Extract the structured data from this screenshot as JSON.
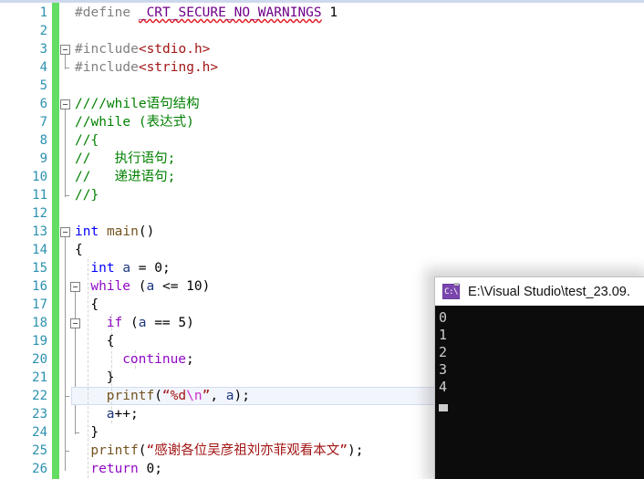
{
  "editor": {
    "name": "code-editor",
    "line_numbers": [
      1,
      2,
      3,
      4,
      5,
      6,
      7,
      8,
      9,
      10,
      11,
      12,
      13,
      14,
      15,
      16,
      17,
      18,
      19,
      20,
      21,
      22,
      23,
      24,
      25,
      26
    ],
    "current_line": 22,
    "lines": [
      {
        "n": 1,
        "indent": 0,
        "segs": [
          {
            "t": "#define ",
            "c": "t-pre"
          },
          {
            "t": "_CRT_SECURE_NO_WARNINGS",
            "c": "t-macro squiggle"
          },
          {
            "t": " ",
            "c": "t-plain"
          },
          {
            "t": "1",
            "c": "t-num"
          }
        ]
      },
      {
        "n": 2,
        "indent": 0,
        "segs": []
      },
      {
        "n": 3,
        "indent": 0,
        "segs": [
          {
            "t": "#include",
            "c": "t-pre"
          },
          {
            "t": "<stdio.h>",
            "c": "t-inc"
          }
        ]
      },
      {
        "n": 4,
        "indent": 0,
        "segs": [
          {
            "t": "#include",
            "c": "t-pre"
          },
          {
            "t": "<string.h>",
            "c": "t-inc"
          }
        ]
      },
      {
        "n": 5,
        "indent": 0,
        "segs": []
      },
      {
        "n": 6,
        "indent": 0,
        "segs": [
          {
            "t": "////while语句结构",
            "c": "t-cmt"
          }
        ]
      },
      {
        "n": 7,
        "indent": 0,
        "segs": [
          {
            "t": "//while (表达式)",
            "c": "t-cmt"
          }
        ]
      },
      {
        "n": 8,
        "indent": 0,
        "segs": [
          {
            "t": "//{",
            "c": "t-cmt"
          }
        ]
      },
      {
        "n": 9,
        "indent": 0,
        "segs": [
          {
            "t": "//   执行语句;",
            "c": "t-cmt"
          }
        ]
      },
      {
        "n": 10,
        "indent": 0,
        "segs": [
          {
            "t": "//   递进语句;",
            "c": "t-cmt"
          }
        ]
      },
      {
        "n": 11,
        "indent": 0,
        "segs": [
          {
            "t": "//}",
            "c": "t-cmt"
          }
        ]
      },
      {
        "n": 12,
        "indent": 0,
        "segs": []
      },
      {
        "n": 13,
        "indent": 0,
        "segs": [
          {
            "t": "int",
            "c": "t-kw"
          },
          {
            "t": " ",
            "c": "t-plain"
          },
          {
            "t": "main",
            "c": "t-fn"
          },
          {
            "t": "()",
            "c": "t-plain"
          }
        ]
      },
      {
        "n": 14,
        "indent": 0,
        "segs": [
          {
            "t": "{",
            "c": "t-plain"
          }
        ]
      },
      {
        "n": 15,
        "indent": 1,
        "segs": [
          {
            "t": "int",
            "c": "t-kw"
          },
          {
            "t": " ",
            "c": "t-plain"
          },
          {
            "t": "a",
            "c": "t-id"
          },
          {
            "t": " = ",
            "c": "t-plain"
          },
          {
            "t": "0",
            "c": "t-num"
          },
          {
            "t": ";",
            "c": "t-plain"
          }
        ]
      },
      {
        "n": 16,
        "indent": 1,
        "segs": [
          {
            "t": "while",
            "c": "t-ctl"
          },
          {
            "t": " (",
            "c": "t-plain"
          },
          {
            "t": "a",
            "c": "t-id"
          },
          {
            "t": " <= ",
            "c": "t-plain"
          },
          {
            "t": "10",
            "c": "t-num"
          },
          {
            "t": ")",
            "c": "t-plain"
          }
        ]
      },
      {
        "n": 17,
        "indent": 1,
        "segs": [
          {
            "t": "{",
            "c": "t-plain"
          }
        ]
      },
      {
        "n": 18,
        "indent": 2,
        "segs": [
          {
            "t": "if",
            "c": "t-ctl"
          },
          {
            "t": " (",
            "c": "t-plain"
          },
          {
            "t": "a",
            "c": "t-id"
          },
          {
            "t": " == ",
            "c": "t-plain"
          },
          {
            "t": "5",
            "c": "t-num"
          },
          {
            "t": ")",
            "c": "t-plain"
          }
        ]
      },
      {
        "n": 19,
        "indent": 2,
        "segs": [
          {
            "t": "{",
            "c": "t-plain"
          }
        ]
      },
      {
        "n": 20,
        "indent": 3,
        "segs": [
          {
            "t": "continue",
            "c": "t-ctl"
          },
          {
            "t": ";",
            "c": "t-plain"
          }
        ]
      },
      {
        "n": 21,
        "indent": 2,
        "segs": [
          {
            "t": "}",
            "c": "t-plain"
          }
        ]
      },
      {
        "n": 22,
        "indent": 2,
        "segs": [
          {
            "t": "printf",
            "c": "t-fn"
          },
          {
            "t": "(",
            "c": "t-plain"
          },
          {
            "t": "“%d",
            "c": "t-str"
          },
          {
            "t": "\\n",
            "c": "t-esc"
          },
          {
            "t": "”",
            "c": "t-str"
          },
          {
            "t": ", ",
            "c": "t-plain"
          },
          {
            "t": "a",
            "c": "t-id"
          },
          {
            "t": ");",
            "c": "t-plain"
          }
        ]
      },
      {
        "n": 23,
        "indent": 2,
        "segs": [
          {
            "t": "a",
            "c": "t-id"
          },
          {
            "t": "++;",
            "c": "t-plain"
          }
        ]
      },
      {
        "n": 24,
        "indent": 1,
        "segs": [
          {
            "t": "}",
            "c": "t-plain"
          }
        ]
      },
      {
        "n": 25,
        "indent": 1,
        "segs": [
          {
            "t": "printf",
            "c": "t-fn"
          },
          {
            "t": "(",
            "c": "t-plain"
          },
          {
            "t": "“感谢各位吴彦祖刘亦菲观看本文”",
            "c": "t-str"
          },
          {
            "t": ");",
            "c": "t-plain"
          }
        ]
      },
      {
        "n": 26,
        "indent": 1,
        "segs": [
          {
            "t": "return",
            "c": "t-ctl"
          },
          {
            "t": " ",
            "c": "t-plain"
          },
          {
            "t": "0",
            "c": "t-num"
          },
          {
            "t": ";",
            "c": "t-plain"
          }
        ]
      }
    ],
    "fold_boxes": [
      3,
      6,
      13,
      16,
      18
    ],
    "colors": {
      "line_number": "#2b91af",
      "change_bar": "#63dd63",
      "comment": "#008000",
      "string": "#a31515",
      "keyword": "#0000ff",
      "control_keyword": "#8f08c4",
      "preprocessor": "#808080",
      "macro": "#6f008a",
      "function": "#74531f",
      "identifier": "#1f377f",
      "current_line_bg": "#f2f5fc"
    }
  },
  "console": {
    "title": "E:\\Visual Studio\\test_23.09.",
    "icon": "console-window-icon",
    "icon_glyph": "C:\\",
    "output_lines": [
      "0",
      "1",
      "2",
      "3",
      "4"
    ],
    "background": "#0c0c0c",
    "text_color": "#cccccc"
  }
}
